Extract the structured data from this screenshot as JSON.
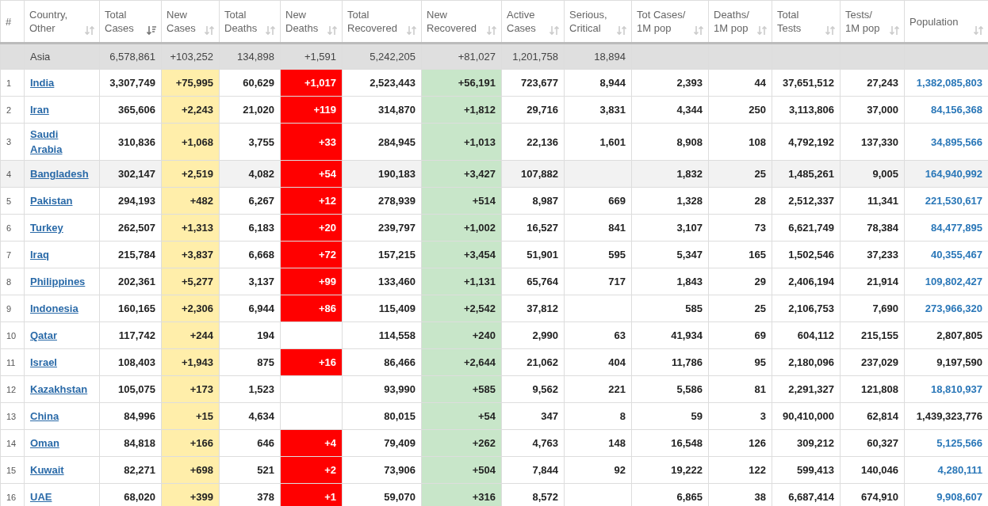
{
  "columns": [
    {
      "lines": [
        "#"
      ],
      "sortable": false,
      "sorted": false
    },
    {
      "lines": [
        "Country,",
        "Other"
      ],
      "sortable": true,
      "sorted": false
    },
    {
      "lines": [
        "Total",
        "Cases"
      ],
      "sortable": true,
      "sorted": true
    },
    {
      "lines": [
        "New",
        "Cases"
      ],
      "sortable": true,
      "sorted": false
    },
    {
      "lines": [
        "Total",
        "Deaths"
      ],
      "sortable": true,
      "sorted": false
    },
    {
      "lines": [
        "New",
        "Deaths"
      ],
      "sortable": true,
      "sorted": false
    },
    {
      "lines": [
        "Total",
        "Recovered"
      ],
      "sortable": true,
      "sorted": false
    },
    {
      "lines": [
        "New",
        "Recovered"
      ],
      "sortable": true,
      "sorted": false
    },
    {
      "lines": [
        "Active",
        "Cases"
      ],
      "sortable": true,
      "sorted": false
    },
    {
      "lines": [
        "Serious,",
        "Critical"
      ],
      "sortable": true,
      "sorted": false
    },
    {
      "lines": [
        "Tot Cases/",
        "1M pop"
      ],
      "sortable": true,
      "sorted": false
    },
    {
      "lines": [
        "Deaths/",
        "1M pop"
      ],
      "sortable": true,
      "sorted": false
    },
    {
      "lines": [
        "Total",
        "Tests"
      ],
      "sortable": true,
      "sorted": false
    },
    {
      "lines": [
        "Tests/",
        "1M pop"
      ],
      "sortable": true,
      "sorted": false
    },
    {
      "lines": [
        "Population"
      ],
      "sortable": true,
      "sorted": false
    }
  ],
  "summary": {
    "country": "Asia",
    "total_cases": "6,578,861",
    "new_cases": "+103,252",
    "total_deaths": "134,898",
    "new_deaths": "+1,591",
    "total_recovered": "5,242,205",
    "new_recovered": "+81,027",
    "active_cases": "1,201,758",
    "serious_critical": "18,894"
  },
  "rows": [
    {
      "n": "1",
      "country": "India",
      "total_cases": "3,307,749",
      "new_cases": "+75,995",
      "total_deaths": "60,629",
      "new_deaths": "+1,017",
      "total_recovered": "2,523,443",
      "new_recovered": "+56,191",
      "active_cases": "723,677",
      "serious_critical": "8,944",
      "cases_per_1m": "2,393",
      "deaths_per_1m": "44",
      "total_tests": "37,651,512",
      "tests_per_1m": "27,243",
      "population": "1,382,085,803",
      "population_linked": true,
      "highlighted": false
    },
    {
      "n": "2",
      "country": "Iran",
      "total_cases": "365,606",
      "new_cases": "+2,243",
      "total_deaths": "21,020",
      "new_deaths": "+119",
      "total_recovered": "314,870",
      "new_recovered": "+1,812",
      "active_cases": "29,716",
      "serious_critical": "3,831",
      "cases_per_1m": "4,344",
      "deaths_per_1m": "250",
      "total_tests": "3,113,806",
      "tests_per_1m": "37,000",
      "population": "84,156,368",
      "population_linked": true,
      "highlighted": false
    },
    {
      "n": "3",
      "country": "Saudi Arabia",
      "total_cases": "310,836",
      "new_cases": "+1,068",
      "total_deaths": "3,755",
      "new_deaths": "+33",
      "total_recovered": "284,945",
      "new_recovered": "+1,013",
      "active_cases": "22,136",
      "serious_critical": "1,601",
      "cases_per_1m": "8,908",
      "deaths_per_1m": "108",
      "total_tests": "4,792,192",
      "tests_per_1m": "137,330",
      "population": "34,895,566",
      "population_linked": true,
      "highlighted": false
    },
    {
      "n": "4",
      "country": "Bangladesh",
      "total_cases": "302,147",
      "new_cases": "+2,519",
      "total_deaths": "4,082",
      "new_deaths": "+54",
      "total_recovered": "190,183",
      "new_recovered": "+3,427",
      "active_cases": "107,882",
      "cases_per_1m": "1,832",
      "deaths_per_1m": "25",
      "total_tests": "1,485,261",
      "tests_per_1m": "9,005",
      "population": "164,940,992",
      "population_linked": true,
      "highlighted": true
    },
    {
      "n": "5",
      "country": "Pakistan",
      "total_cases": "294,193",
      "new_cases": "+482",
      "total_deaths": "6,267",
      "new_deaths": "+12",
      "total_recovered": "278,939",
      "new_recovered": "+514",
      "active_cases": "8,987",
      "serious_critical": "669",
      "cases_per_1m": "1,328",
      "deaths_per_1m": "28",
      "total_tests": "2,512,337",
      "tests_per_1m": "11,341",
      "population": "221,530,617",
      "population_linked": true,
      "highlighted": false
    },
    {
      "n": "6",
      "country": "Turkey",
      "total_cases": "262,507",
      "new_cases": "+1,313",
      "total_deaths": "6,183",
      "new_deaths": "+20",
      "total_recovered": "239,797",
      "new_recovered": "+1,002",
      "active_cases": "16,527",
      "serious_critical": "841",
      "cases_per_1m": "3,107",
      "deaths_per_1m": "73",
      "total_tests": "6,621,749",
      "tests_per_1m": "78,384",
      "population": "84,477,895",
      "population_linked": true,
      "highlighted": false
    },
    {
      "n": "7",
      "country": "Iraq",
      "total_cases": "215,784",
      "new_cases": "+3,837",
      "total_deaths": "6,668",
      "new_deaths": "+72",
      "total_recovered": "157,215",
      "new_recovered": "+3,454",
      "active_cases": "51,901",
      "serious_critical": "595",
      "cases_per_1m": "5,347",
      "deaths_per_1m": "165",
      "total_tests": "1,502,546",
      "tests_per_1m": "37,233",
      "population": "40,355,467",
      "population_linked": true,
      "highlighted": false
    },
    {
      "n": "8",
      "country": "Philippines",
      "total_cases": "202,361",
      "new_cases": "+5,277",
      "total_deaths": "3,137",
      "new_deaths": "+99",
      "total_recovered": "133,460",
      "new_recovered": "+1,131",
      "active_cases": "65,764",
      "serious_critical": "717",
      "cases_per_1m": "1,843",
      "deaths_per_1m": "29",
      "total_tests": "2,406,194",
      "tests_per_1m": "21,914",
      "population": "109,802,427",
      "population_linked": true,
      "highlighted": false
    },
    {
      "n": "9",
      "country": "Indonesia",
      "total_cases": "160,165",
      "new_cases": "+2,306",
      "total_deaths": "6,944",
      "new_deaths": "+86",
      "total_recovered": "115,409",
      "new_recovered": "+2,542",
      "active_cases": "37,812",
      "cases_per_1m": "585",
      "deaths_per_1m": "25",
      "total_tests": "2,106,753",
      "tests_per_1m": "7,690",
      "population": "273,966,320",
      "population_linked": true,
      "highlighted": false
    },
    {
      "n": "10",
      "country": "Qatar",
      "total_cases": "117,742",
      "new_cases": "+244",
      "total_deaths": "194",
      "total_recovered": "114,558",
      "new_recovered": "+240",
      "active_cases": "2,990",
      "serious_critical": "63",
      "cases_per_1m": "41,934",
      "deaths_per_1m": "69",
      "total_tests": "604,112",
      "tests_per_1m": "215,155",
      "population": "2,807,805",
      "population_linked": false,
      "highlighted": false
    },
    {
      "n": "11",
      "country": "Israel",
      "total_cases": "108,403",
      "new_cases": "+1,943",
      "total_deaths": "875",
      "new_deaths": "+16",
      "total_recovered": "86,466",
      "new_recovered": "+2,644",
      "active_cases": "21,062",
      "serious_critical": "404",
      "cases_per_1m": "11,786",
      "deaths_per_1m": "95",
      "total_tests": "2,180,096",
      "tests_per_1m": "237,029",
      "population": "9,197,590",
      "population_linked": false,
      "highlighted": false
    },
    {
      "n": "12",
      "country": "Kazakhstan",
      "total_cases": "105,075",
      "new_cases": "+173",
      "total_deaths": "1,523",
      "total_recovered": "93,990",
      "new_recovered": "+585",
      "active_cases": "9,562",
      "serious_critical": "221",
      "cases_per_1m": "5,586",
      "deaths_per_1m": "81",
      "total_tests": "2,291,327",
      "tests_per_1m": "121,808",
      "population": "18,810,937",
      "population_linked": true,
      "highlighted": false
    },
    {
      "n": "13",
      "country": "China",
      "total_cases": "84,996",
      "new_cases": "+15",
      "total_deaths": "4,634",
      "total_recovered": "80,015",
      "new_recovered": "+54",
      "active_cases": "347",
      "serious_critical": "8",
      "cases_per_1m": "59",
      "deaths_per_1m": "3",
      "total_tests": "90,410,000",
      "tests_per_1m": "62,814",
      "population": "1,439,323,776",
      "population_linked": false,
      "highlighted": false
    },
    {
      "n": "14",
      "country": "Oman",
      "total_cases": "84,818",
      "new_cases": "+166",
      "total_deaths": "646",
      "new_deaths": "+4",
      "total_recovered": "79,409",
      "new_recovered": "+262",
      "active_cases": "4,763",
      "serious_critical": "148",
      "cases_per_1m": "16,548",
      "deaths_per_1m": "126",
      "total_tests": "309,212",
      "tests_per_1m": "60,327",
      "population": "5,125,566",
      "population_linked": true,
      "highlighted": false
    },
    {
      "n": "15",
      "country": "Kuwait",
      "total_cases": "82,271",
      "new_cases": "+698",
      "total_deaths": "521",
      "new_deaths": "+2",
      "total_recovered": "73,906",
      "new_recovered": "+504",
      "active_cases": "7,844",
      "serious_critical": "92",
      "cases_per_1m": "19,222",
      "deaths_per_1m": "122",
      "total_tests": "599,413",
      "tests_per_1m": "140,046",
      "population": "4,280,111",
      "population_linked": true,
      "highlighted": false
    },
    {
      "n": "16",
      "country": "UAE",
      "total_cases": "68,020",
      "new_cases": "+399",
      "total_deaths": "378",
      "new_deaths": "+1",
      "total_recovered": "59,070",
      "new_recovered": "+316",
      "active_cases": "8,572",
      "cases_per_1m": "6,865",
      "deaths_per_1m": "38",
      "total_tests": "6,687,414",
      "tests_per_1m": "674,910",
      "population": "9,908,607",
      "population_linked": true,
      "highlighted": false
    }
  ]
}
